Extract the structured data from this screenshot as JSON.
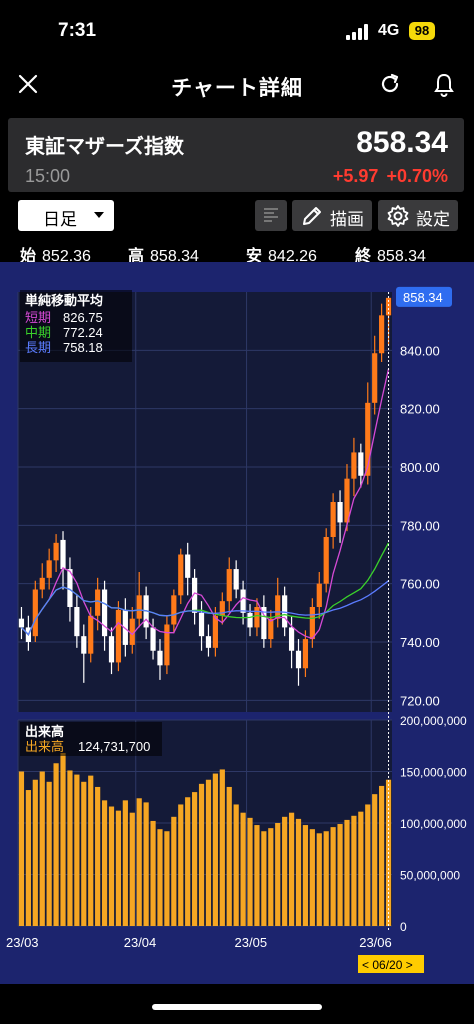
{
  "status": {
    "time": "7:31",
    "network": "4G",
    "battery": "98"
  },
  "nav": {
    "title": "チャート詳細",
    "close_icon": "close-icon",
    "reload_icon": "reload-icon",
    "bell_icon": "bell-icon"
  },
  "quote": {
    "name": "東証マザーズ指数",
    "price": "858.34",
    "time": "15:00",
    "change": "+5.97",
    "change_pct": "+0.70%",
    "change_color": "#ff3b30"
  },
  "toolbar": {
    "period": "日足",
    "draw_label": "描画",
    "settings_label": "設定"
  },
  "ohlc": {
    "open_label": "始",
    "open": "852.36",
    "high_label": "高",
    "high": "858.34",
    "low_label": "安",
    "low": "842.26",
    "close_label": "終",
    "close": "858.34"
  },
  "ma_legend": {
    "title": "単純移動平均",
    "items": [
      {
        "label": "短期",
        "value": "826.75",
        "color": "#d64ad6"
      },
      {
        "label": "中期",
        "value": "772.24",
        "color": "#3ad12b"
      },
      {
        "label": "長期",
        "value": "758.18",
        "color": "#5b7cff"
      }
    ]
  },
  "volume_legend": {
    "title": "出来高",
    "label": "出来高",
    "value": "124,731,700"
  },
  "chart_data": {
    "type": "candlestick",
    "price_ticks": [
      "840.00",
      "820.00",
      "800.00",
      "780.00",
      "760.00",
      "740.00",
      "720.00"
    ],
    "price_tick_values": [
      840,
      820,
      800,
      780,
      760,
      740,
      720
    ],
    "price_range": [
      716,
      860
    ],
    "volume_ticks": [
      "200,000,000",
      "150,000,000",
      "100,000,000",
      "50,000,000",
      "0"
    ],
    "volume_tick_values": [
      200000000,
      150000000,
      100000000,
      50000000,
      0
    ],
    "volume_range": [
      0,
      200000000
    ],
    "x_labels": [
      "23/03",
      "23/04",
      "23/05",
      "23/06"
    ],
    "x_label_index": [
      0,
      17,
      33,
      51
    ],
    "last_price_label": "858.34",
    "cursor_label": "< 06/20 >",
    "up_color": "#ff7a1a",
    "down_color": "#ffffff",
    "volume_color": "#f5a623",
    "candles": [
      [
        748,
        745,
        752,
        741
      ],
      [
        745,
        740,
        749,
        737
      ],
      [
        742,
        758,
        761,
        740
      ],
      [
        758,
        762,
        767,
        755
      ],
      [
        762,
        768,
        772,
        758
      ],
      [
        768,
        774,
        777,
        764
      ],
      [
        775,
        765,
        778,
        758
      ],
      [
        765,
        752,
        769,
        747
      ],
      [
        752,
        742,
        756,
        738
      ],
      [
        742,
        736,
        746,
        726
      ],
      [
        736,
        749,
        752,
        733
      ],
      [
        749,
        758,
        762,
        744
      ],
      [
        758,
        742,
        761,
        737
      ],
      [
        742,
        733,
        745,
        729
      ],
      [
        733,
        751,
        754,
        730
      ],
      [
        751,
        739,
        755,
        735
      ],
      [
        739,
        748,
        752,
        736
      ],
      [
        748,
        756,
        764,
        745
      ],
      [
        756,
        745,
        759,
        741
      ],
      [
        745,
        737,
        748,
        734
      ],
      [
        737,
        732,
        741,
        727
      ],
      [
        732,
        746,
        749,
        729
      ],
      [
        746,
        756,
        758,
        743
      ],
      [
        756,
        770,
        772,
        753
      ],
      [
        770,
        762,
        774,
        756
      ],
      [
        762,
        750,
        765,
        746
      ],
      [
        750,
        742,
        754,
        737
      ],
      [
        742,
        738,
        746,
        735
      ],
      [
        738,
        749,
        752,
        735
      ],
      [
        749,
        754,
        757,
        746
      ],
      [
        754,
        765,
        769,
        750
      ],
      [
        765,
        758,
        768,
        755
      ],
      [
        758,
        750,
        761,
        746
      ],
      [
        750,
        745,
        753,
        742
      ],
      [
        745,
        752,
        755,
        742
      ],
      [
        752,
        741,
        756,
        738
      ],
      [
        741,
        748,
        751,
        738
      ],
      [
        748,
        756,
        762,
        745
      ],
      [
        756,
        745,
        759,
        742
      ],
      [
        745,
        737,
        749,
        731
      ],
      [
        737,
        731,
        741,
        725
      ],
      [
        731,
        741,
        744,
        728
      ],
      [
        741,
        752,
        755,
        738
      ],
      [
        752,
        760,
        764,
        748
      ],
      [
        760,
        776,
        779,
        757
      ],
      [
        776,
        788,
        791,
        772
      ],
      [
        788,
        781,
        792,
        774
      ],
      [
        781,
        796,
        801,
        778
      ],
      [
        796,
        805,
        810,
        790
      ],
      [
        805,
        797,
        808,
        793
      ],
      [
        797,
        822,
        829,
        794
      ],
      [
        822,
        839,
        845,
        818
      ],
      [
        839,
        852,
        856,
        836
      ],
      [
        852,
        858,
        858,
        842
      ]
    ],
    "volumes": [
      150,
      132,
      142,
      150,
      140,
      158,
      168,
      151,
      147,
      140,
      146,
      135,
      122,
      116,
      112,
      122,
      110,
      124,
      120,
      102,
      94,
      92,
      106,
      118,
      125,
      130,
      138,
      142,
      148,
      152,
      135,
      118,
      110,
      105,
      98,
      92,
      95,
      100,
      106,
      110,
      104,
      98,
      94,
      90,
      92,
      96,
      99,
      103,
      107,
      111,
      118,
      128,
      136,
      142,
      150,
      146
    ]
  }
}
